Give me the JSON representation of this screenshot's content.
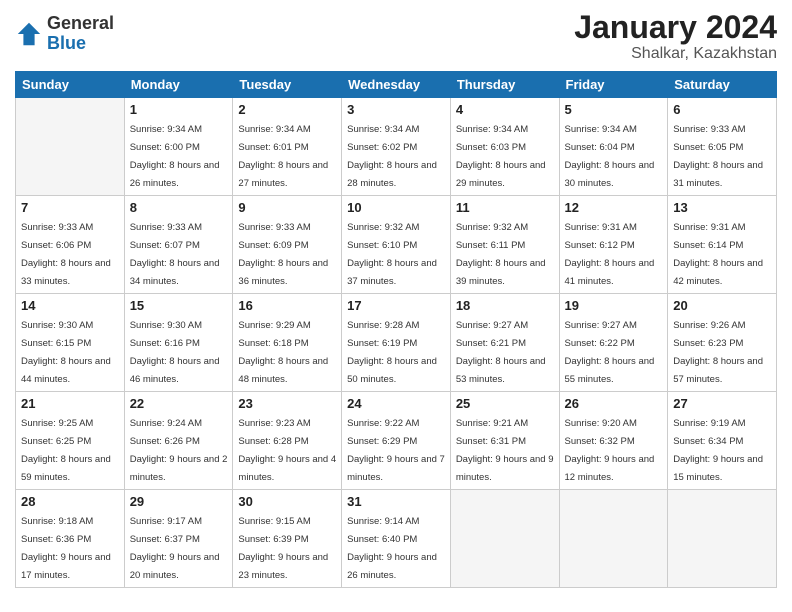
{
  "header": {
    "logo_general": "General",
    "logo_blue": "Blue",
    "month_title": "January 2024",
    "location": "Shalkar, Kazakhstan"
  },
  "days_of_week": [
    "Sunday",
    "Monday",
    "Tuesday",
    "Wednesday",
    "Thursday",
    "Friday",
    "Saturday"
  ],
  "weeks": [
    [
      {
        "day": "",
        "empty": true
      },
      {
        "day": "1",
        "sunrise": "Sunrise: 9:34 AM",
        "sunset": "Sunset: 6:00 PM",
        "daylight": "Daylight: 8 hours and 26 minutes."
      },
      {
        "day": "2",
        "sunrise": "Sunrise: 9:34 AM",
        "sunset": "Sunset: 6:01 PM",
        "daylight": "Daylight: 8 hours and 27 minutes."
      },
      {
        "day": "3",
        "sunrise": "Sunrise: 9:34 AM",
        "sunset": "Sunset: 6:02 PM",
        "daylight": "Daylight: 8 hours and 28 minutes."
      },
      {
        "day": "4",
        "sunrise": "Sunrise: 9:34 AM",
        "sunset": "Sunset: 6:03 PM",
        "daylight": "Daylight: 8 hours and 29 minutes."
      },
      {
        "day": "5",
        "sunrise": "Sunrise: 9:34 AM",
        "sunset": "Sunset: 6:04 PM",
        "daylight": "Daylight: 8 hours and 30 minutes."
      },
      {
        "day": "6",
        "sunrise": "Sunrise: 9:33 AM",
        "sunset": "Sunset: 6:05 PM",
        "daylight": "Daylight: 8 hours and 31 minutes."
      }
    ],
    [
      {
        "day": "7",
        "sunrise": "Sunrise: 9:33 AM",
        "sunset": "Sunset: 6:06 PM",
        "daylight": "Daylight: 8 hours and 33 minutes."
      },
      {
        "day": "8",
        "sunrise": "Sunrise: 9:33 AM",
        "sunset": "Sunset: 6:07 PM",
        "daylight": "Daylight: 8 hours and 34 minutes."
      },
      {
        "day": "9",
        "sunrise": "Sunrise: 9:33 AM",
        "sunset": "Sunset: 6:09 PM",
        "daylight": "Daylight: 8 hours and 36 minutes."
      },
      {
        "day": "10",
        "sunrise": "Sunrise: 9:32 AM",
        "sunset": "Sunset: 6:10 PM",
        "daylight": "Daylight: 8 hours and 37 minutes."
      },
      {
        "day": "11",
        "sunrise": "Sunrise: 9:32 AM",
        "sunset": "Sunset: 6:11 PM",
        "daylight": "Daylight: 8 hours and 39 minutes."
      },
      {
        "day": "12",
        "sunrise": "Sunrise: 9:31 AM",
        "sunset": "Sunset: 6:12 PM",
        "daylight": "Daylight: 8 hours and 41 minutes."
      },
      {
        "day": "13",
        "sunrise": "Sunrise: 9:31 AM",
        "sunset": "Sunset: 6:14 PM",
        "daylight": "Daylight: 8 hours and 42 minutes."
      }
    ],
    [
      {
        "day": "14",
        "sunrise": "Sunrise: 9:30 AM",
        "sunset": "Sunset: 6:15 PM",
        "daylight": "Daylight: 8 hours and 44 minutes."
      },
      {
        "day": "15",
        "sunrise": "Sunrise: 9:30 AM",
        "sunset": "Sunset: 6:16 PM",
        "daylight": "Daylight: 8 hours and 46 minutes."
      },
      {
        "day": "16",
        "sunrise": "Sunrise: 9:29 AM",
        "sunset": "Sunset: 6:18 PM",
        "daylight": "Daylight: 8 hours and 48 minutes."
      },
      {
        "day": "17",
        "sunrise": "Sunrise: 9:28 AM",
        "sunset": "Sunset: 6:19 PM",
        "daylight": "Daylight: 8 hours and 50 minutes."
      },
      {
        "day": "18",
        "sunrise": "Sunrise: 9:27 AM",
        "sunset": "Sunset: 6:21 PM",
        "daylight": "Daylight: 8 hours and 53 minutes."
      },
      {
        "day": "19",
        "sunrise": "Sunrise: 9:27 AM",
        "sunset": "Sunset: 6:22 PM",
        "daylight": "Daylight: 8 hours and 55 minutes."
      },
      {
        "day": "20",
        "sunrise": "Sunrise: 9:26 AM",
        "sunset": "Sunset: 6:23 PM",
        "daylight": "Daylight: 8 hours and 57 minutes."
      }
    ],
    [
      {
        "day": "21",
        "sunrise": "Sunrise: 9:25 AM",
        "sunset": "Sunset: 6:25 PM",
        "daylight": "Daylight: 8 hours and 59 minutes."
      },
      {
        "day": "22",
        "sunrise": "Sunrise: 9:24 AM",
        "sunset": "Sunset: 6:26 PM",
        "daylight": "Daylight: 9 hours and 2 minutes."
      },
      {
        "day": "23",
        "sunrise": "Sunrise: 9:23 AM",
        "sunset": "Sunset: 6:28 PM",
        "daylight": "Daylight: 9 hours and 4 minutes."
      },
      {
        "day": "24",
        "sunrise": "Sunrise: 9:22 AM",
        "sunset": "Sunset: 6:29 PM",
        "daylight": "Daylight: 9 hours and 7 minutes."
      },
      {
        "day": "25",
        "sunrise": "Sunrise: 9:21 AM",
        "sunset": "Sunset: 6:31 PM",
        "daylight": "Daylight: 9 hours and 9 minutes."
      },
      {
        "day": "26",
        "sunrise": "Sunrise: 9:20 AM",
        "sunset": "Sunset: 6:32 PM",
        "daylight": "Daylight: 9 hours and 12 minutes."
      },
      {
        "day": "27",
        "sunrise": "Sunrise: 9:19 AM",
        "sunset": "Sunset: 6:34 PM",
        "daylight": "Daylight: 9 hours and 15 minutes."
      }
    ],
    [
      {
        "day": "28",
        "sunrise": "Sunrise: 9:18 AM",
        "sunset": "Sunset: 6:36 PM",
        "daylight": "Daylight: 9 hours and 17 minutes."
      },
      {
        "day": "29",
        "sunrise": "Sunrise: 9:17 AM",
        "sunset": "Sunset: 6:37 PM",
        "daylight": "Daylight: 9 hours and 20 minutes."
      },
      {
        "day": "30",
        "sunrise": "Sunrise: 9:15 AM",
        "sunset": "Sunset: 6:39 PM",
        "daylight": "Daylight: 9 hours and 23 minutes."
      },
      {
        "day": "31",
        "sunrise": "Sunrise: 9:14 AM",
        "sunset": "Sunset: 6:40 PM",
        "daylight": "Daylight: 9 hours and 26 minutes."
      },
      {
        "day": "",
        "empty": true
      },
      {
        "day": "",
        "empty": true
      },
      {
        "day": "",
        "empty": true
      }
    ]
  ]
}
